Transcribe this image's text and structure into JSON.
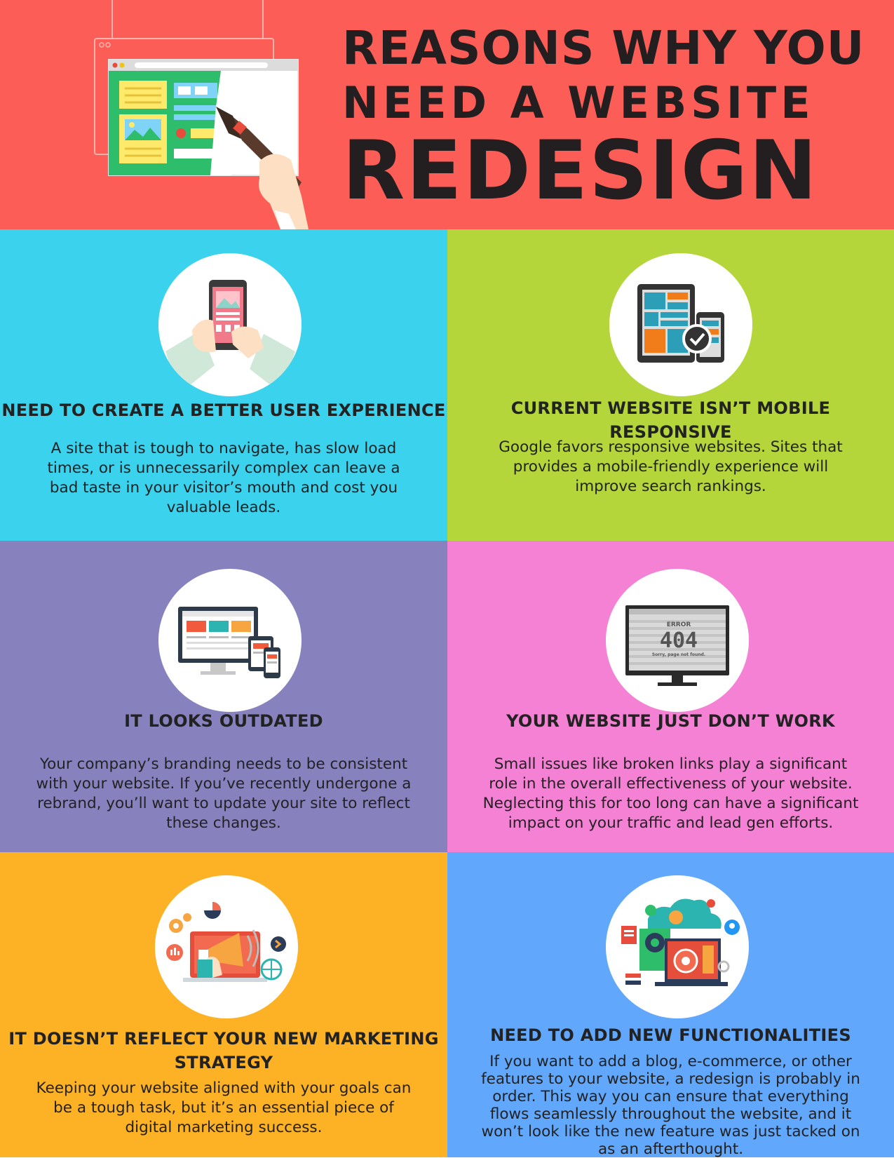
{
  "header": {
    "title_line1": "REASONS WHY YOU",
    "title_line2": "NEED A WEBSITE",
    "title_line3": "REDESIGN"
  },
  "panels": [
    {
      "heading": "NEED TO CREATE A BETTER USER EXPERIENCE",
      "body": "A site that is tough to navigate, has slow load times, or is unnecessarily complex can leave a bad taste in your visitor’s mouth and cost you valuable leads.",
      "color": "#3bd2ee",
      "icon": "smartphone-touch-icon"
    },
    {
      "heading": "CURRENT WEBSITE ISN’T MOBILE RESPONSIVE",
      "body": "Google favors responsive websites. Sites that provides a mobile-friendly experience will improve search rankings.",
      "color": "#b4d63a",
      "icon": "responsive-devices-check-icon"
    },
    {
      "heading": "IT LOOKS OUTDATED",
      "body": "Your company’s branding needs to be consistent with your website. If you’ve recently undergone a rebrand, you’ll want to update your site to reflect these changes.",
      "color": "#8782bd",
      "icon": "multi-device-website-icon"
    },
    {
      "heading": "YOUR WEBSITE JUST DON’T WORK",
      "body": "Small issues like broken links play a significant role in the overall effectiveness of your website. Neglecting this for too long can have a significant impact on your traffic and lead gen efforts.",
      "color": "#f581d5",
      "icon": "error-404-monitor-icon",
      "icon_text_error": "ERROR",
      "icon_text_code": "404",
      "icon_text_sorry": "Sorry, page not found."
    },
    {
      "heading": "IT DOESN’T REFLECT YOUR NEW MARKETING STRATEGY",
      "body": "Keeping your website aligned with your goals can be a tough task, but it’s an essential piece of digital marketing success.",
      "color": "#fdb124",
      "icon": "megaphone-marketing-icon"
    },
    {
      "heading": "NEED TO ADD NEW FUNCTIONALITIES",
      "body": "If you want to add a blog, e-commerce, or other features to your website, a redesign is probably in order. This way you can ensure that everything flows seamlessly throughout the website, and it won’t look like the new feature was just tacked on as an afterthought.",
      "color": "#61a7fb",
      "icon": "functionality-gears-icon"
    }
  ]
}
